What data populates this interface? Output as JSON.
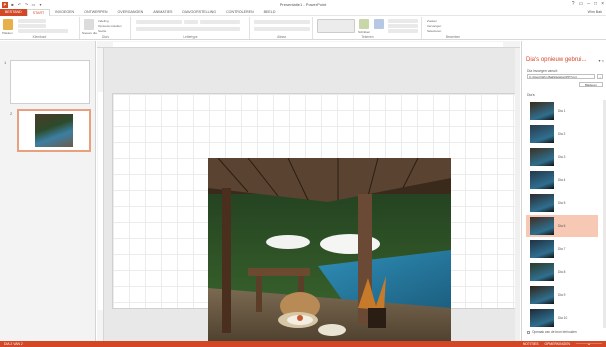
{
  "window": {
    "title": "Presentatie1 - PowerPoint",
    "user": "Wim Bak"
  },
  "ribbon_tabs": [
    "BESTAND",
    "START",
    "INVOEGEN",
    "ONTWERPEN",
    "OVERGANGEN",
    "ANIMATIES",
    "DIAVOORSTELLING",
    "CONTROLEREN",
    "BEELD"
  ],
  "ribbon": {
    "groups": [
      "Klembord",
      "Dia's",
      "Lettertype",
      "Alinea",
      "Tekenen",
      "Bewerken"
    ],
    "paste_label": "Plakken",
    "new_slide_label": "Nieuwe dia",
    "section_label": "Sectie",
    "layout_label": "Indeling",
    "reset_label": "Opnieuw instellen",
    "arrange_label": "Schikken",
    "quick_styles_label": "Snelle stijlen",
    "find_label": "Zoeken",
    "replace_label": "Vervangen",
    "select_label": "Selecteren"
  },
  "thumbnails": {
    "slide1_number": "1",
    "slide2_number": "2"
  },
  "reuse_pane": {
    "title": "Dia's opnieuw gebrui...",
    "insert_from_label": "Dia invoegen vanuit:",
    "path_value": "C:\\Users\\Wim Bak\\Desktop\\PPT.ppt",
    "browse_label": "Bladeren",
    "slides_label": "Dia's:",
    "slides": [
      "Dia 1",
      "Dia 2",
      "Dia 3",
      "Dia 4",
      "Dia 5",
      "Dia 6",
      "Dia 7",
      "Dia 8",
      "Dia 9",
      "Dia 10"
    ],
    "selected_index": 5,
    "keep_format_label": "Opmaak van de bron behouden"
  },
  "status": {
    "left": "DIA 2 VAN 2",
    "notes": "NOTITIES",
    "comments": "OPMERKINGEN"
  },
  "colors": {
    "accent": "#d24726",
    "selection": "#f7c8b3"
  }
}
